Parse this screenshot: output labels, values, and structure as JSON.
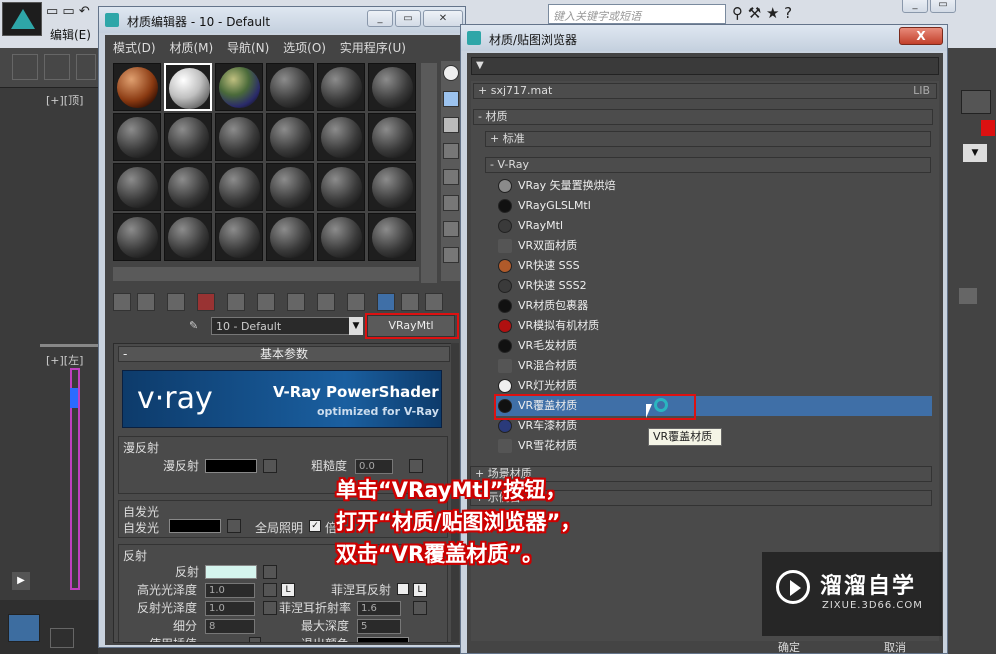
{
  "max": {
    "edit_menu": "编辑(E)",
    "search_placeholder": "键入关键字或短语",
    "viewport_top": "[+][顶]",
    "viewport_left": "[+][左]"
  },
  "material_editor": {
    "title": "材质编辑器 - 10 - Default",
    "menu": [
      "模式(D)",
      "材质(M)",
      "导航(N)",
      "选项(O)",
      "实用程序(U)"
    ],
    "material_name": "10 - Default",
    "type_button": "VRayMtl",
    "rollout_title": "基本参数",
    "banner": {
      "logo": "v·ray",
      "line1": "V-Ray PowerShader",
      "line2": "optimized for V-Ray"
    },
    "diffuse": {
      "group": "漫反射",
      "diffuse_label": "漫反射",
      "roughness_label": "粗糙度",
      "roughness_value": "0.0"
    },
    "self_illum": {
      "group": "自发光",
      "label": "自发光",
      "gi_label": "全局照明",
      "gi_checked": "✓",
      "partial": "倍"
    },
    "reflection": {
      "group": "反射",
      "reflect_label": "反射",
      "hilight_gloss_label": "高光光泽度",
      "hilight_gloss_value": "1.0",
      "lock": "L",
      "refl_gloss_label": "反射光泽度",
      "refl_gloss_value": "1.0",
      "subdivs_label": "细分",
      "subdivs_value": "8",
      "use_interp_label": "使用插值",
      "fresnel_label": "菲涅耳反射",
      "fresnel_lock": "L",
      "fresnel_ior_label": "菲涅耳折射率",
      "fresnel_ior_value": "1.6",
      "max_depth_label": "最大深度",
      "max_depth_value": "5",
      "exit_color_label": "退出颜色"
    }
  },
  "browser": {
    "title": "材质/贴图浏览器",
    "close": "X",
    "lib_item": "+ sxj717.mat",
    "lib_tag": "LIB",
    "materials_header": "- 材质",
    "standard_header": "+ 标准",
    "vray_header": "- V-Ray",
    "items": [
      {
        "label": "VRay 矢量置换烘焙",
        "color": "#8a8a8a"
      },
      {
        "label": "VRayGLSLMtl",
        "color": "#111111"
      },
      {
        "label": "VRayMtl",
        "color": "#3a3a3a"
      },
      {
        "label": "VR双面材质",
        "color": ""
      },
      {
        "label": "VR快速 SSS",
        "color": "#b05a2a"
      },
      {
        "label": "VR快速 SSS2",
        "color": "#3a3a3a"
      },
      {
        "label": "VR材质包裹器",
        "color": "#111111"
      },
      {
        "label": "VR模拟有机材质",
        "color": "#b01010"
      },
      {
        "label": "VR毛发材质",
        "color": "#111111"
      },
      {
        "label": "VR混合材质",
        "color": ""
      },
      {
        "label": "VR灯光材质",
        "color": "#f0f0f0"
      },
      {
        "label": "VR覆盖材质",
        "color": "#111111"
      },
      {
        "label": "VR车漆材质",
        "color": "#2a3a7a"
      },
      {
        "label": "VR雪花材质",
        "color": ""
      }
    ],
    "tooltip": "VR覆盖材质",
    "scene_materials": "+ 场景材质",
    "sample_slots": "+ 示例窗",
    "ok": "确定",
    "cancel": "取消"
  },
  "annotation": {
    "line1": "单击“VRayMtl”按钮，",
    "line2": "打开“材质/贴图浏览器”，",
    "line3": "双击“VR覆盖材质”。"
  },
  "watermark": {
    "title": "溜溜自学",
    "url": "ZIXUE.3D66.COM"
  }
}
